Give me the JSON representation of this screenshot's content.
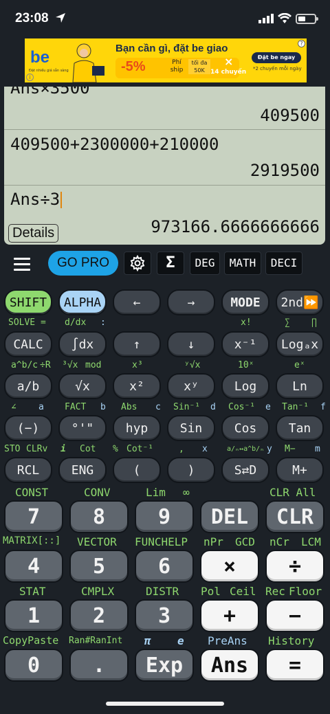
{
  "status": {
    "time": "23:08"
  },
  "ad": {
    "logo": "be",
    "logo_sub": "Đặt nhiều giá sẵn sàng",
    "headline": "Bạn cần gì, đặt be giao",
    "discount": "-5%",
    "fee_label": "Phí ship",
    "max_label": "tối đa 50K",
    "trips": "14 chuyến",
    "cta": "Đặt be ngay",
    "cta_sub": "*2 chuyến mỗi ngày",
    "help": "?",
    "info": "i"
  },
  "display": {
    "history_top": "Ans×3500",
    "result_1": "409500",
    "expr_2": "409500+2300000+210000",
    "result_2": "2919500",
    "current_input": "Ans÷3",
    "current_result": "973166.6666666666",
    "details_label": "Details"
  },
  "toolbar": {
    "gopro": "GO PRO",
    "sigma": "Σ",
    "deg": "DEG",
    "math": "MATH",
    "deci": "DECI"
  },
  "keys": {
    "row1": [
      "SHIFT",
      "ALPHA",
      "←",
      "→",
      "MODE",
      "2nd⏩"
    ],
    "row1_labels": [
      "SOLVE =",
      "d/dx",
      ":",
      "x!",
      "∑",
      "∏"
    ],
    "row2": [
      "CALC",
      "∫dx",
      "↑",
      "↓",
      "x⁻¹",
      "Logₐx"
    ],
    "row2_labels": [
      "a^b/c",
      "÷R",
      "³√x",
      "mod",
      "x³",
      "ʸ√x",
      "10ˣ",
      "eˣ"
    ],
    "row3": [
      "a/b",
      "√x",
      "x²",
      "xʸ",
      "Log",
      "Ln"
    ],
    "row3_labels": [
      "∠",
      "a",
      "FACT",
      "b",
      "Abs",
      "c",
      "Sin⁻¹",
      "d",
      "Cos⁻¹",
      "e",
      "Tan⁻¹",
      "f"
    ],
    "row4": [
      "(−)",
      "°'\"",
      "hyp",
      "Sin",
      "Cos",
      "Tan"
    ],
    "row4_labels": [
      "STO",
      "CLRv",
      "i",
      "Cot",
      "%",
      "Cot⁻¹",
      ",",
      "x",
      "a/ₙ↔a^b/ₙ",
      "y",
      "M−",
      "m"
    ],
    "row5": [
      "RCL",
      "ENG",
      "(",
      ")",
      "S⇄D",
      "M+"
    ],
    "row5_labels": [
      "CONST",
      "CONV",
      "Lim",
      "∞",
      "CLR All"
    ],
    "row6": [
      "7",
      "8",
      "9",
      "DEL",
      "CLR"
    ],
    "row6_labels": [
      "MATRIX[::]",
      "VECTOR",
      "FUNCHELP",
      "nPr",
      "GCD",
      "nCr",
      "LCM"
    ],
    "row7": [
      "4",
      "5",
      "6",
      "×",
      "÷"
    ],
    "row7_labels": [
      "STAT",
      "CMPLX",
      "DISTR",
      "Pol",
      "Ceil",
      "Rec",
      "Floor"
    ],
    "row8": [
      "1",
      "2",
      "3",
      "+",
      "−"
    ],
    "row8_labels": [
      "CopyPaste",
      "Ran#RanInt",
      "π",
      "e",
      "PreAns",
      "History"
    ],
    "row9": [
      "0",
      ".",
      "Exp",
      "Ans",
      "="
    ]
  },
  "colors": {
    "shift": "#8ed86e",
    "alpha": "#a9d3f5",
    "display": "#c8d2c1",
    "gopro": "#1ea3e6"
  }
}
